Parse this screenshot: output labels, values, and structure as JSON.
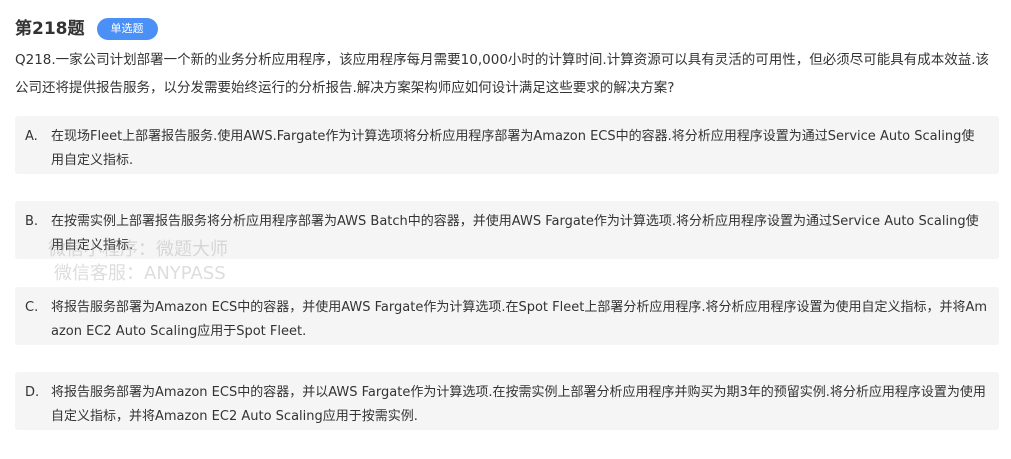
{
  "header": {
    "question_number": "第218题",
    "question_type": "单选题"
  },
  "question": {
    "text": "Q218.一家公司计划部署一个新的业务分析应用程序，该应用程序每月需要10,000小时的计算时间.计算资源可以具有灵活的可用性，但必须尽可能具有成本效益.该公司还将提供报告服务，以分发需要始终运行的分析报告.解决方案架构师应如何设计满足这些要求的解决方案?"
  },
  "options": [
    {
      "letter": "A.",
      "text": "在现场Fleet上部署报告服务.使用AWS.Fargate作为计算选项将分析应用程序部署为Amazon ECS中的容器.将分析应用程序设置为通过Service Auto Scaling使用自定义指标."
    },
    {
      "letter": "B.",
      "text": "在按需实例上部署报告服务将分析应用程序部署为AWS Batch中的容器，并使用AWS Fargate作为计算选项.将分析应用程序设置为通过Service Auto Scaling使用自定义指标."
    },
    {
      "letter": "C.",
      "text": "将报告服务部署为Amazon ECS中的容器，并使用AWS Fargate作为计算选项.在Spot Fleet上部署分析应用程序.将分析应用程序设置为使用自定义指标，并将Amazon EC2 Auto Scaling应用于Spot Fleet."
    },
    {
      "letter": "D.",
      "text": "将报告服务部署为Amazon ECS中的容器，并以AWS Fargate作为计算选项.在按需实例上部署分析应用程序并购买为期3年的预留实例.将分析应用程序设置为使用自定义指标，并将Amazon EC2 Auto Scaling应用于按需实例."
    }
  ],
  "watermark": {
    "line1": "微信小程序：微题大师",
    "line2": "微信客服：ANYPASS"
  },
  "colors": {
    "badge_background": "#4a90f7",
    "option_background": "#f5f5f5",
    "text": "#333333"
  }
}
